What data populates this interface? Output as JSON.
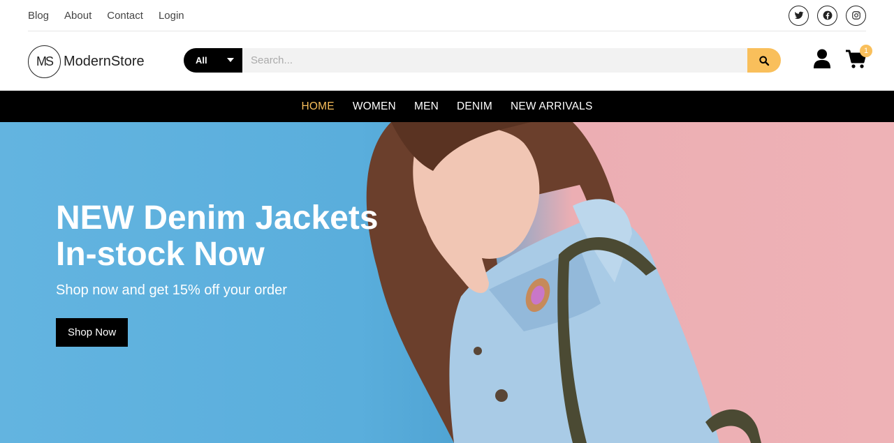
{
  "topbar": {
    "links": [
      {
        "label": "Blog"
      },
      {
        "label": "About"
      },
      {
        "label": "Contact"
      },
      {
        "label": "Login"
      }
    ],
    "socials": [
      "twitter-icon",
      "facebook-icon",
      "instagram-icon"
    ]
  },
  "header": {
    "logo_mark": "MS",
    "logo_text": "ModernStore",
    "search": {
      "category": "All",
      "placeholder": "Search..."
    },
    "cart_count": "1"
  },
  "nav": {
    "items": [
      {
        "label": "HOME",
        "active": true
      },
      {
        "label": "WOMEN"
      },
      {
        "label": "MEN"
      },
      {
        "label": "DENIM"
      },
      {
        "label": "NEW ARRIVALS"
      }
    ]
  },
  "hero": {
    "title": "NEW Denim Jackets In-stock Now",
    "subtitle": "Shop now and get 15% off your order",
    "button": "Shop Now"
  },
  "colors": {
    "accent": "#f9bf5b",
    "nav_bg": "#000000",
    "hero_blue": "#5aaedc",
    "hero_pink": "#eeb2b6"
  }
}
